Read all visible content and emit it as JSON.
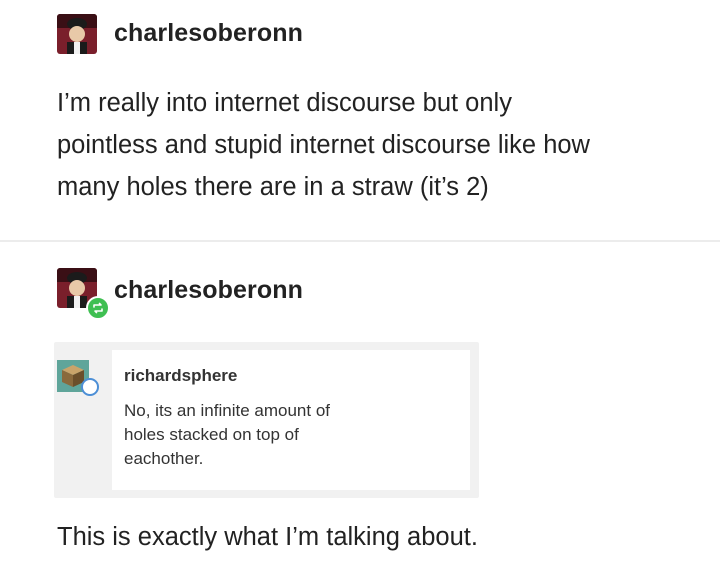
{
  "post": {
    "username": "charlesoberonn",
    "text_lines": [
      "I’m really into internet discourse but only",
      "pointless and stupid internet discourse like how",
      "many holes there are in a straw (it’s 2)"
    ]
  },
  "reblog": {
    "username": "charlesoberonn",
    "quoted": {
      "username": "richardsphere",
      "text_lines": [
        "No, its an infinite amount of",
        "holes stacked on top of",
        "eachother."
      ]
    },
    "comment": "This is exactly what I’m talking about."
  },
  "icons": {
    "post_avatar": "user-avatar-icon",
    "reblog_avatar": "user-avatar-icon",
    "reblog_badge": "reblog-icon",
    "quoted_avatar": "cube-avatar-icon"
  },
  "colors": {
    "reblog_badge": "#3fbf52",
    "quoted_badge_ring": "#4d8fd6"
  }
}
